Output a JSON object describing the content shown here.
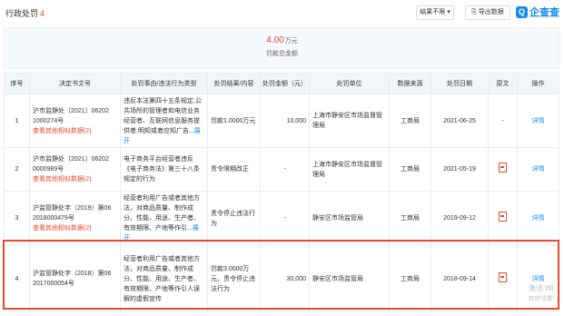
{
  "header": {
    "title": "行政处罚",
    "count": "4",
    "filter_label": "结果不限 ▾",
    "export_label": "导出数据",
    "logo_text": "企查查",
    "logo_mark": "Q"
  },
  "summary": {
    "amount": "4.00",
    "unit": "万元",
    "label": "罚款总金额"
  },
  "table": {
    "headers": [
      "序号",
      "决定书文号",
      "处罚事由/违法行为类型",
      "处罚结果/内容",
      "处罚金额（元）",
      "处罚单位",
      "数据来源",
      "处罚日期",
      "原文",
      "操作"
    ],
    "rows": [
      {
        "index": "1",
        "doc_no": "沪市监静处〔2021〕06202 1000274号",
        "related": "查看其他相似数据(2)",
        "reason": "违反本法第四十五条规定,公共场所的管理者和电信业务经营者、互联网信息服务提供者,明知或者应知广告...",
        "reason_more": "展开",
        "result": "罚款1.0000万元",
        "amount": "10,000",
        "unit": "上海市静安区市场监督管理局",
        "source": "工商局",
        "date": "2021-06-25",
        "original": "-",
        "action": "详情"
      },
      {
        "index": "2",
        "doc_no": "沪市监静处〔2021〕06202 0000989号",
        "related": "查看其他相似数据(2)",
        "reason": "电子商务平台经营者违反《电子商务法》第三十八条规定的行为",
        "reason_more": "",
        "result": "责令限期改正",
        "amount": "-",
        "unit": "上海市静安区市场监督管理局",
        "source": "工商局",
        "date": "2021-05-19",
        "original": "pdf",
        "action": "详情"
      },
      {
        "index": "3",
        "doc_no": "沪监管静处字（2019）第06 2018000479号",
        "related": "查看其他相似数据(2)",
        "reason": "经营者利用广告或者其他方法，对商品质量、制作成分、性能、用途、生产者、有效期限、产地等作引...",
        "reason_more": "展开",
        "result": "责令停止违法行为",
        "amount": "-",
        "unit": "静安区市场监管局",
        "source": "工商局",
        "date": "2019-09-12",
        "original": "pdf",
        "action": "详情"
      },
      {
        "index": "4",
        "doc_no": "沪监管静处字（2018）第06 2017000054号",
        "related": "",
        "reason": "经营者利用广告或者其他方法，对商品质量、制作成分、性能、用途、生产者、有效期限、产地等作引人误解的虚假宣传",
        "reason_more": "",
        "result": "罚款3.0000万元，责令停止违法行为",
        "amount": "30,000",
        "unit": "静安区市场监管局",
        "source": "工商局",
        "date": "2018-09-14",
        "original": "pdf",
        "action": "详情"
      }
    ]
  },
  "watermark": {
    "line1": "激活 Wi",
    "line2": "转到\"设置\""
  },
  "colors": {
    "accent": "#e8492f",
    "link": "#128bed"
  }
}
